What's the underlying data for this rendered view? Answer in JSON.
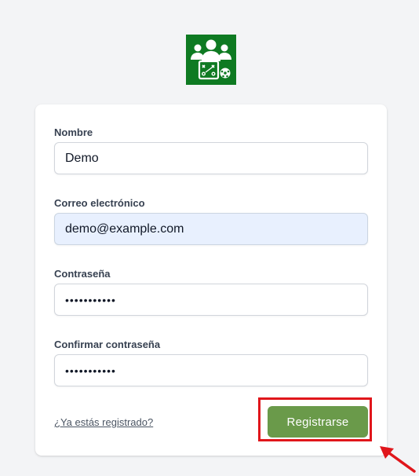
{
  "logo": {
    "icon": "team-strategy-icon",
    "color": "#0e7a22"
  },
  "form": {
    "name_label": "Nombre",
    "name_value": "Demo",
    "email_label": "Correo electrónico",
    "email_value": "demo@example.com",
    "password_label": "Contraseña",
    "password_value": "•••••••••••",
    "confirm_label": "Confirmar contraseña",
    "confirm_value": "•••••••••••",
    "login_link": "¿Ya estás registrado?",
    "submit_label": "Registrarse"
  },
  "annotation": {
    "color": "#e0161b",
    "icon": "arrow-pointer-icon"
  }
}
